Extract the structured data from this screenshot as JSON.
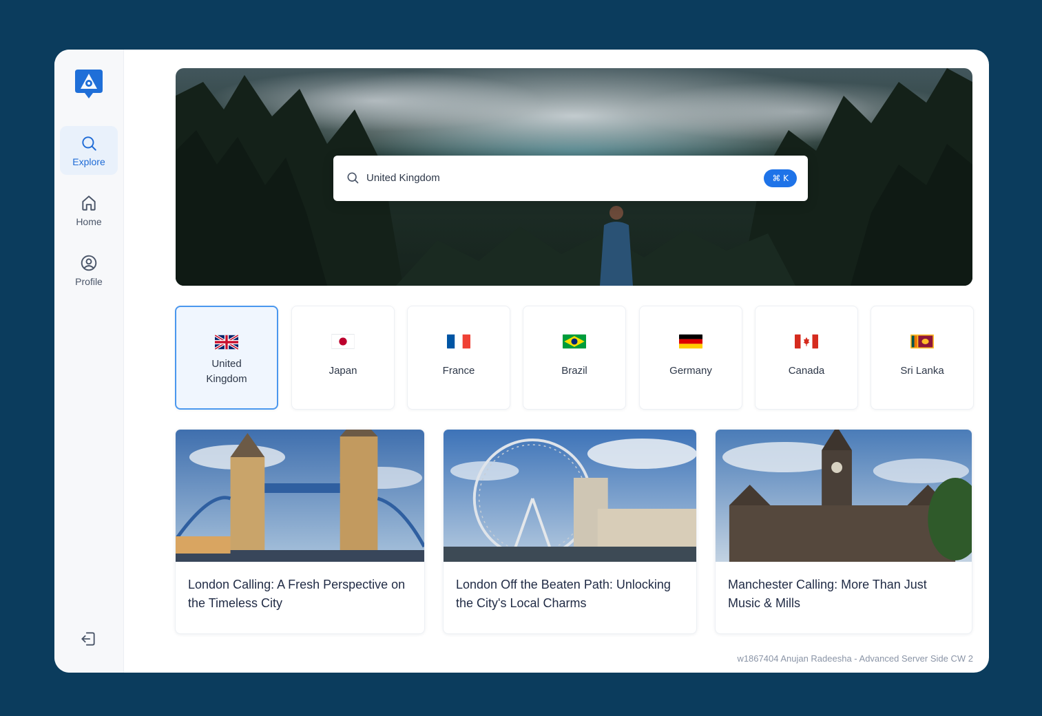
{
  "nav": {
    "items": [
      {
        "label": "Explore",
        "icon": "search-icon",
        "active": true
      },
      {
        "label": "Home",
        "icon": "home-icon",
        "active": false
      },
      {
        "label": "Profile",
        "icon": "user-circle-icon",
        "active": false
      }
    ],
    "logout_icon": "logout-icon"
  },
  "search": {
    "value": "United Kingdom",
    "shortcut": "⌘ K"
  },
  "countries": [
    {
      "name": "United Kingdom",
      "selected": true
    },
    {
      "name": "Japan",
      "selected": false
    },
    {
      "name": "France",
      "selected": false
    },
    {
      "name": "Brazil",
      "selected": false
    },
    {
      "name": "Germany",
      "selected": false
    },
    {
      "name": "Canada",
      "selected": false
    },
    {
      "name": "Sri Lanka",
      "selected": false
    }
  ],
  "articles": [
    {
      "title": "London Calling: A Fresh Perspective on the Timeless City"
    },
    {
      "title": "London Off the Beaten Path: Unlocking the City's Local Charms"
    },
    {
      "title": "Manchester Calling: More Than Just Music & Mills"
    }
  ],
  "footer": "w1867404 Anujan Radeesha - Advanced Server Side CW 2",
  "colors": {
    "background": "#0b3c5d",
    "accent": "#1e73e8",
    "selected_border": "#4a97ee"
  }
}
